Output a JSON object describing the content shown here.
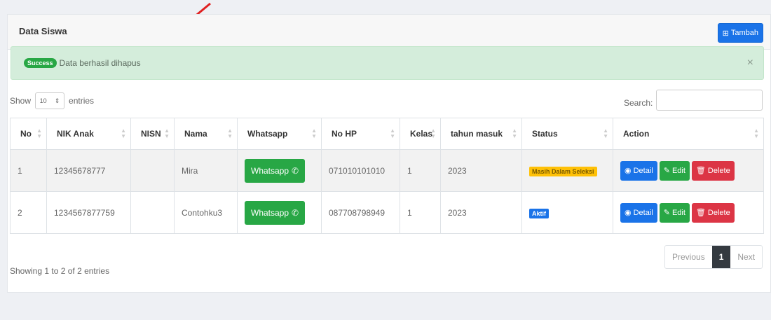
{
  "header": {
    "title": "Data Siswa",
    "add_button": "Tambah"
  },
  "alert": {
    "badge": "Success",
    "message": "Data berhasil dihapus",
    "close": "×"
  },
  "length": {
    "show": "Show",
    "value": "10",
    "entries": "entries"
  },
  "search": {
    "label": "Search:"
  },
  "columns": [
    "No",
    "NIK Anak",
    "NISN",
    "Nama",
    "Whatsapp",
    "No HP",
    "Kelas",
    "tahun masuk",
    "Status",
    "Action"
  ],
  "rows": [
    {
      "no": "1",
      "nik": "12345678777",
      "nisn": "",
      "nama": "Mira",
      "whatsapp": "Whatsapp",
      "hp": "071010101010",
      "kelas": "1",
      "tahun": "2023",
      "status": "Masih Dalam Seleksi"
    },
    {
      "no": "2",
      "nik": "1234567877759",
      "nisn": "",
      "nama": "Contohku3",
      "whatsapp": "Whatsapp",
      "hp": "087708798949",
      "kelas": "1",
      "tahun": "2023",
      "status": "Aktif"
    }
  ],
  "actions": {
    "detail": "Detail",
    "edit": "Edit",
    "delete": "Delete"
  },
  "footer": {
    "info": "Showing 1 to 2 of 2 entries",
    "previous": "Previous",
    "page": "1",
    "next": "Next"
  },
  "colors": {
    "primary": "#1a73e8",
    "success": "#28a745",
    "danger": "#dc3545",
    "warning": "#ffc107",
    "annotation": "#e02020"
  }
}
